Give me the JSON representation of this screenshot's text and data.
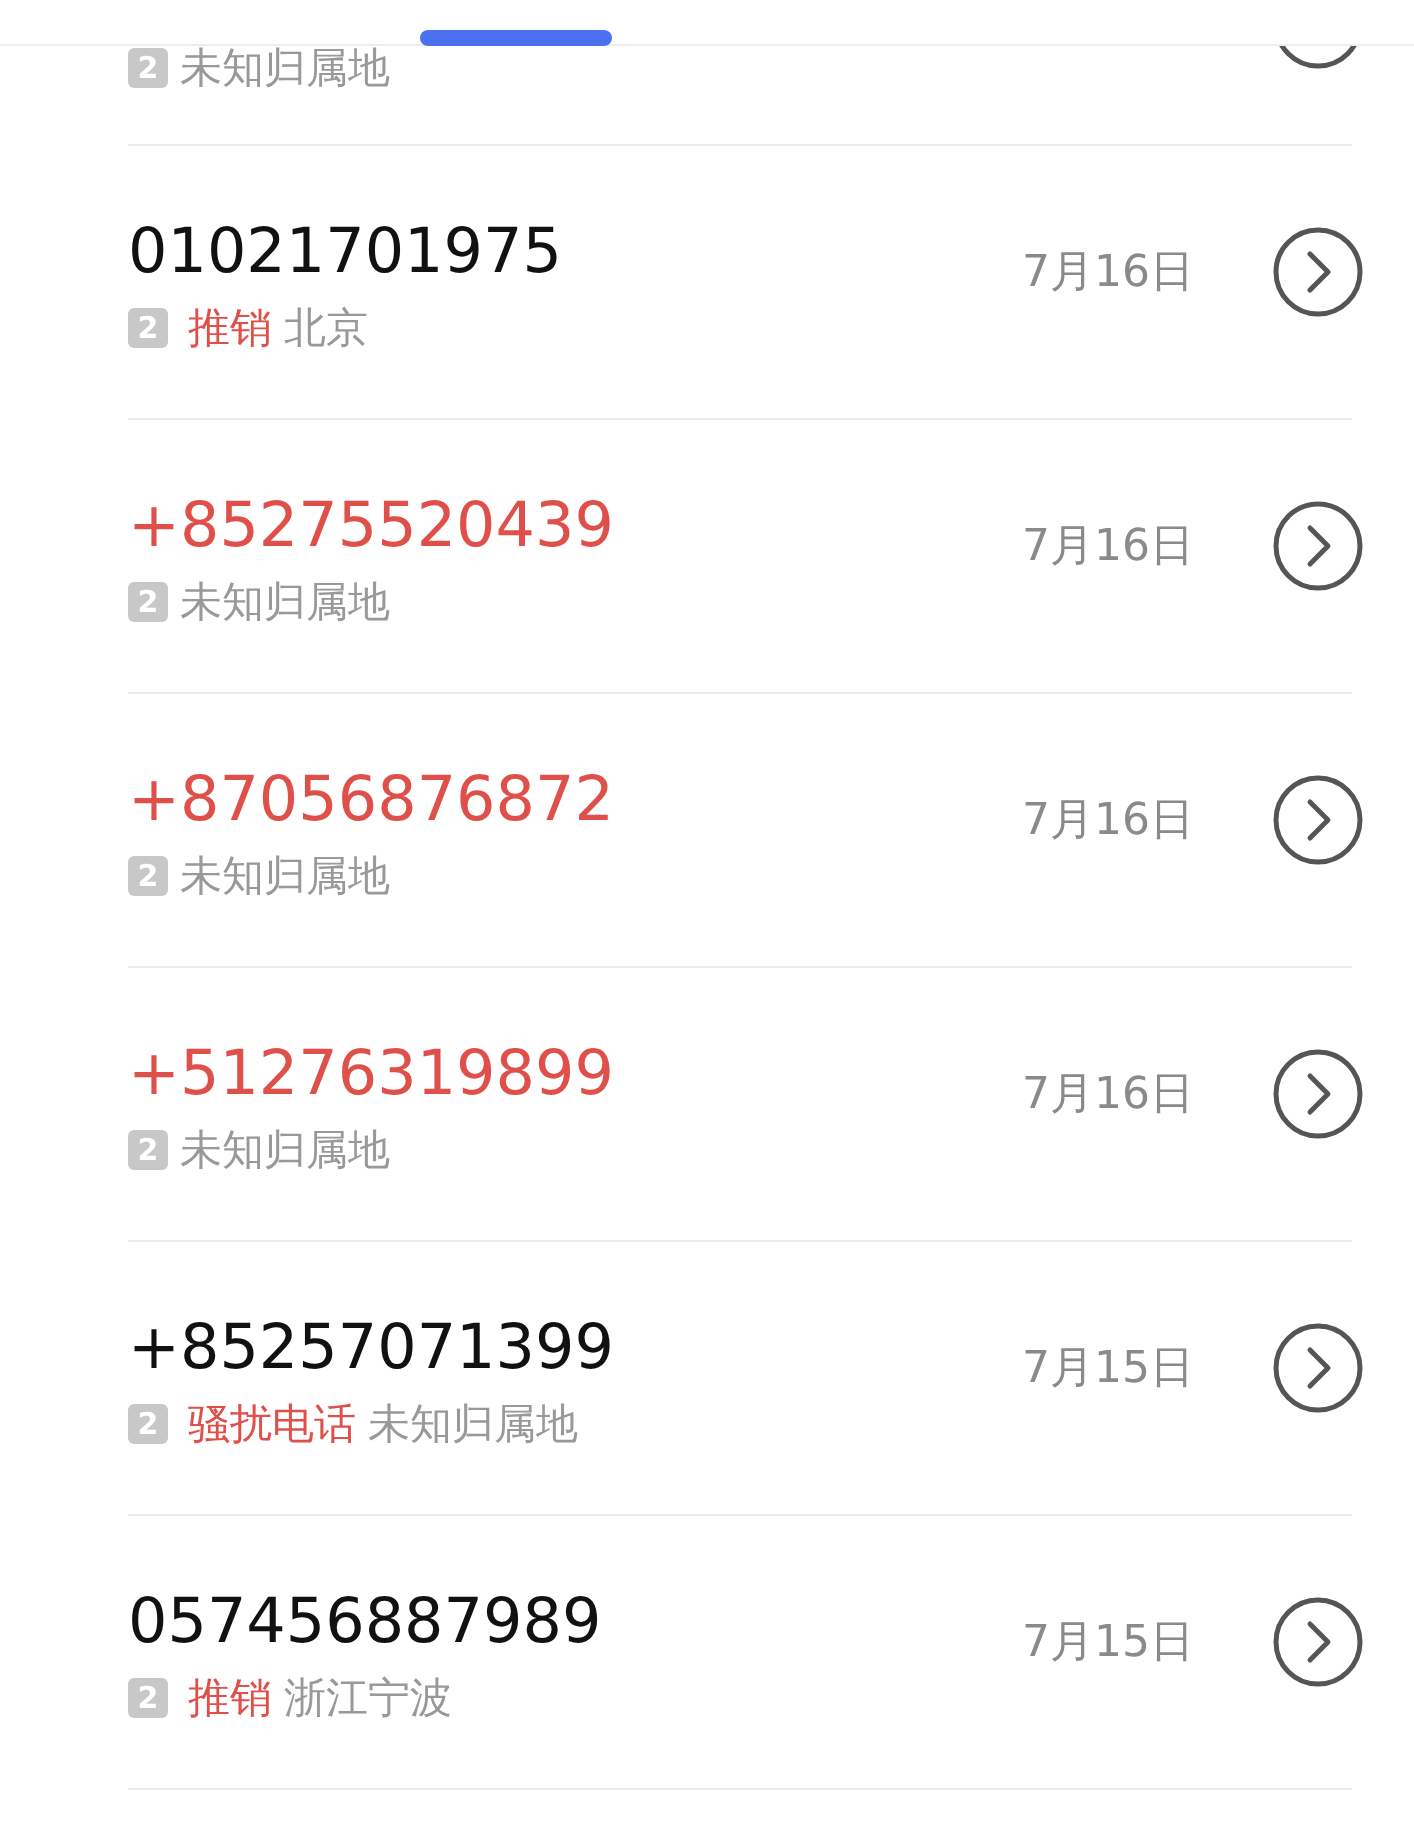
{
  "calls": [
    {
      "sim": "2",
      "location": "未知归属地"
    },
    {
      "number": "01021701975",
      "missed": false,
      "sim": "2",
      "tag": "推销",
      "location": "北京",
      "date": "7月16日"
    },
    {
      "number": "+85275520439",
      "missed": true,
      "sim": "2",
      "location": "未知归属地",
      "date": "7月16日"
    },
    {
      "number": "+87056876872",
      "missed": true,
      "sim": "2",
      "location": "未知归属地",
      "date": "7月16日"
    },
    {
      "number": "+51276319899",
      "missed": true,
      "sim": "2",
      "location": "未知归属地",
      "date": "7月16日"
    },
    {
      "number": "+85257071399",
      "missed": false,
      "sim": "2",
      "tag": "骚扰电话",
      "location": "未知归属地",
      "date": "7月15日"
    },
    {
      "number": "057456887989",
      "missed": false,
      "sim": "2",
      "tag": "推销",
      "location": "浙江宁波",
      "date": "7月15日"
    }
  ]
}
